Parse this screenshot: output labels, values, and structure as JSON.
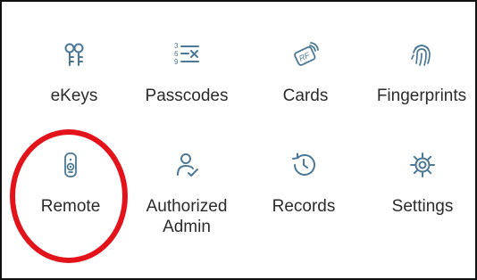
{
  "colors": {
    "icon": "#4b7896",
    "label": "#2b2b2b",
    "annotation": "#e3131b"
  },
  "grid": {
    "items": [
      {
        "label": "eKeys",
        "icon": "ekeys-icon"
      },
      {
        "label": "Passcodes",
        "icon": "passcodes-icon"
      },
      {
        "label": "Cards",
        "icon": "rf-card-icon"
      },
      {
        "label": "Fingerprints",
        "icon": "fingerprint-icon"
      },
      {
        "label": "Remote",
        "icon": "remote-icon"
      },
      {
        "label": "Authorized\nAdmin",
        "icon": "authorized-admin-icon"
      },
      {
        "label": "Records",
        "icon": "history-icon"
      },
      {
        "label": "Settings",
        "icon": "gear-icon"
      }
    ]
  },
  "icon_glyphs": {
    "passcodes_digits": [
      "3",
      "6",
      "9"
    ],
    "cards_text": "RF"
  }
}
